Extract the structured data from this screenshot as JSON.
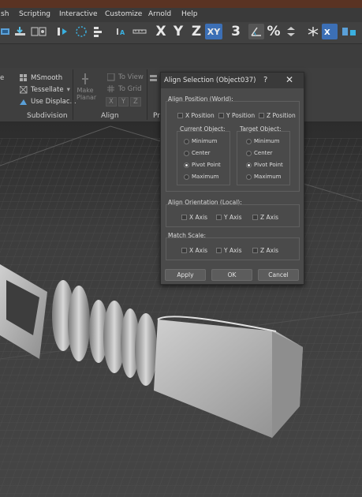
{
  "menu": [
    "sh",
    "Scripting",
    "Interactive",
    "Customize",
    "Arnold",
    "Help"
  ],
  "toolbar": {
    "axis_x": "X",
    "axis_y": "Y",
    "axis_z": "Z",
    "axis_xy": "XY",
    "snap_3": "3",
    "percent": "%"
  },
  "ribbon": {
    "msmooth": "MSmooth",
    "tessellate": "Tessellate",
    "use_displace": "Use Displac...",
    "make_planar": "Make Planar",
    "to_view": "To View",
    "to_grid": "To Grid",
    "x": "X",
    "y": "Y",
    "z": "Z",
    "subdivision": "Subdivision",
    "align": "Align",
    "pr": "Pr"
  },
  "dialog": {
    "title": "Align Selection (Object037)",
    "help": "?",
    "close": "✕",
    "align_position_label": "Align Position (World):",
    "x_position": "X Position",
    "y_position": "Y Position",
    "z_position": "Z Position",
    "current_object_label": "Current Object:",
    "target_object_label": "Target Object:",
    "current_options": [
      "Minimum",
      "Center",
      "Pivot Point",
      "Maximum"
    ],
    "target_options": [
      "Minimum",
      "Center",
      "Pivot Point",
      "Maximum"
    ],
    "current_selected": "Pivot Point",
    "target_selected": "Pivot Point",
    "align_orientation_label": "Align Orientation (Local):",
    "match_scale_label": "Match Scale:",
    "x_axis": "X Axis",
    "y_axis": "Y Axis",
    "z_axis": "Z Axis",
    "apply": "Apply",
    "ok": "OK",
    "cancel": "Cancel"
  },
  "colors": {
    "title_strip": "#5a3323",
    "ui_bg": "#414141",
    "dialog_bg": "#4a4a4a",
    "viewport_bg": "#3b3b3b",
    "highlight": "#3c6fb5"
  }
}
